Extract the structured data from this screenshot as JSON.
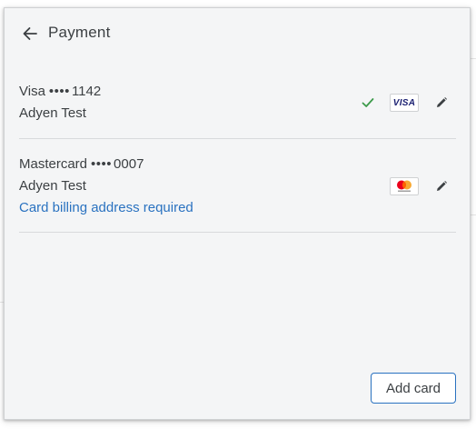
{
  "header": {
    "title": "Payment",
    "back_icon": "arrow-left-icon"
  },
  "cards": [
    {
      "brand": "Visa",
      "mask": "••••",
      "last4": "1142",
      "holder": "Adyen Test",
      "is_default": true,
      "logo_text": "VISA",
      "warning": ""
    },
    {
      "brand": "Mastercard",
      "mask": "••••",
      "last4": "0007",
      "holder": "Adyen Test",
      "is_default": false,
      "logo_text": "mastercard",
      "warning": "Card billing address required"
    }
  ],
  "actions": {
    "add_card_label": "Add card"
  },
  "colors": {
    "dialog_bg": "#f4f5f6",
    "text": "#3c4043",
    "link": "#2a72c0",
    "check": "#3c9a4a",
    "visa_blue": "#1a1f71",
    "mc_red": "#eb001b",
    "mc_orange": "#f79e1b"
  }
}
